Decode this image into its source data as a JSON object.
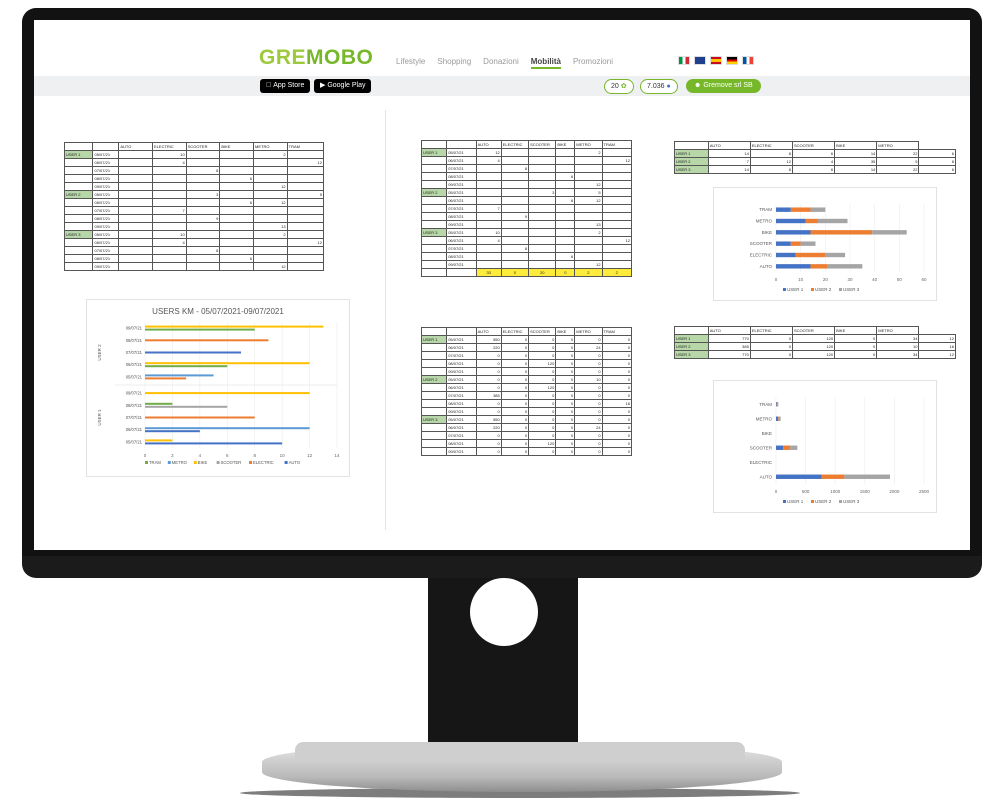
{
  "app": {
    "logo_gre": "GRE",
    "logo_mobo": "MOBO",
    "nav": [
      "Lifestyle",
      "Shopping",
      "Donazioni",
      "Mobilità",
      "Promozioni"
    ],
    "active_nav": "Mobilità",
    "store_apple": "App Store",
    "store_google": "Google Play",
    "points": "20",
    "coins": "7.036",
    "user_button": "Gremove srl SB"
  },
  "tables": {
    "headers": [
      "AUTO",
      "ELECTRIC",
      "SCOOTER",
      "BIKE",
      "METRO",
      "TRAM"
    ],
    "users": [
      "USER 1",
      "USER 2",
      "USER 3"
    ],
    "dates": [
      "05/07/21",
      "06/07/21",
      "07/07/21",
      "08/07/21",
      "09/07/21"
    ],
    "t1": [
      [
        "",
        "10",
        "",
        "",
        "2",
        ""
      ],
      [
        "",
        "4",
        "",
        "",
        "",
        "12"
      ],
      [
        "",
        "",
        "8",
        "",
        "",
        ""
      ],
      [
        "",
        "",
        "",
        "6",
        "",
        ""
      ],
      [
        "",
        "",
        "",
        "",
        "12",
        ""
      ],
      [
        "",
        "",
        "3",
        "",
        "",
        "5"
      ],
      [
        "",
        "",
        "",
        "6",
        "12",
        ""
      ],
      [
        "",
        "7",
        "",
        "",
        "",
        ""
      ],
      [
        "",
        "",
        "9",
        "",
        "",
        ""
      ],
      [
        "",
        "",
        "",
        "",
        "13",
        ""
      ],
      [
        "",
        "10",
        "",
        "",
        "2",
        ""
      ],
      [
        "",
        "4",
        "",
        "",
        "",
        "12"
      ],
      [
        "",
        "",
        "8",
        "",
        "",
        ""
      ],
      [
        "",
        "",
        "",
        "6",
        "",
        ""
      ],
      [
        "",
        "",
        "",
        "",
        "12",
        ""
      ]
    ],
    "t2": [
      [
        "12",
        "",
        "",
        "",
        "2",
        ""
      ],
      [
        "4",
        "",
        "",
        "",
        "",
        "12"
      ],
      [
        "",
        "8",
        "",
        "",
        "",
        ""
      ],
      [
        "",
        "",
        "",
        "6",
        "",
        ""
      ],
      [
        "",
        "",
        "",
        "",
        "12",
        ""
      ],
      [
        "",
        "",
        "3",
        "",
        "5",
        ""
      ],
      [
        "",
        "",
        "",
        "6",
        "12",
        ""
      ],
      [
        "7",
        "",
        "",
        "",
        "",
        ""
      ],
      [
        "",
        "9",
        "",
        "",
        "",
        ""
      ],
      [
        "",
        "",
        "",
        "",
        "13",
        ""
      ],
      [
        "10",
        "",
        "",
        "",
        "2",
        ""
      ],
      [
        "4",
        "",
        "",
        "",
        "",
        "12"
      ],
      [
        "",
        "8",
        "",
        "",
        "",
        ""
      ],
      [
        "",
        "",
        "",
        "6",
        "",
        ""
      ],
      [
        "",
        "",
        "",
        "",
        "12",
        ""
      ]
    ],
    "t2_totals": [
      "33",
      "0",
      "20",
      "0",
      "2",
      "2"
    ],
    "t3": [
      [
        "14",
        "8",
        "6",
        "14",
        "22",
        "6"
      ],
      [
        "7",
        "12",
        "4",
        "35",
        "5",
        "8"
      ],
      [
        "14",
        "8",
        "6",
        "14",
        "22",
        "6"
      ]
    ],
    "t4": [
      [
        "550",
        "0",
        "0",
        "0",
        "0",
        "0"
      ],
      [
        "220",
        "0",
        "0",
        "0",
        "24",
        "0"
      ],
      [
        "0",
        "0",
        "0",
        "0",
        "0",
        "0"
      ],
      [
        "0",
        "0",
        "120",
        "0",
        "0",
        "0"
      ],
      [
        "0",
        "0",
        "0",
        "0",
        "0",
        "0"
      ],
      [
        "0",
        "0",
        "0",
        "0",
        "10",
        "0"
      ],
      [
        "0",
        "0",
        "120",
        "0",
        "0",
        "0"
      ],
      [
        "385",
        "0",
        "0",
        "0",
        "0",
        "0"
      ],
      [
        "0",
        "0",
        "0",
        "0",
        "0",
        "16"
      ],
      [
        "0",
        "0",
        "0",
        "0",
        "0",
        "0"
      ],
      [
        "550",
        "0",
        "0",
        "0",
        "0",
        "0"
      ],
      [
        "220",
        "0",
        "0",
        "0",
        "24",
        "0"
      ],
      [
        "0",
        "0",
        "0",
        "0",
        "0",
        "0"
      ],
      [
        "0",
        "0",
        "120",
        "0",
        "0",
        "0"
      ],
      [
        "0",
        "0",
        "0",
        "0",
        "0",
        "0"
      ]
    ],
    "t5": [
      [
        "770",
        "0",
        "120",
        "0",
        "34",
        "12"
      ],
      [
        "385",
        "0",
        "120",
        "0",
        "10",
        "16"
      ],
      [
        "770",
        "0",
        "120",
        "0",
        "34",
        "12"
      ]
    ]
  },
  "colors": {
    "AUTO": "#4472c4",
    "ELECTRIC": "#ed7d31",
    "SCOOTER": "#a5a5a5",
    "BIKE": "#ffc000",
    "METRO": "#5b9bd5",
    "TRAM": "#70ad47",
    "USER 1": "#4472c4",
    "USER 2": "#ed7d31",
    "USER 3": "#a5a5a5",
    "green": "#76b82a",
    "user_cell": "#b7d7a8",
    "total_row": "#ffeb3b"
  },
  "chart_data": [
    {
      "type": "bar",
      "title": "USERS KM - 05/07/2021-09/07/2021",
      "groups": [
        "USER 1",
        "USER 2"
      ],
      "categories": [
        "05/07/21",
        "06/07/21",
        "07/07/21",
        "08/07/21",
        "09/07/21"
      ],
      "series_order": [
        "TRAM",
        "METRO",
        "BIKE",
        "SCOOTER",
        "ELECTRIC",
        "AUTO"
      ],
      "series": [
        {
          "name": "AUTO",
          "values": [
            0,
            0,
            0,
            0,
            0,
            0,
            0,
            0,
            0,
            0
          ]
        },
        {
          "name": "ELECTRIC",
          "values": [
            0,
            0,
            3,
            0,
            0,
            0,
            0,
            0,
            0,
            0
          ]
        },
        {
          "name": "SCOOTER",
          "values": [
            0,
            0,
            0,
            0,
            0,
            0,
            0,
            0,
            0,
            0
          ]
        },
        {
          "name": "BIKE",
          "values": [
            0,
            0,
            0,
            0,
            0,
            0,
            0,
            0,
            0,
            0
          ]
        },
        {
          "name": "METRO",
          "values": [
            0,
            0,
            0,
            0,
            0,
            0,
            0,
            0,
            0,
            0
          ]
        },
        {
          "name": "TRAM",
          "values": [
            0,
            0,
            0,
            0,
            0,
            0,
            0,
            0,
            0,
            0
          ]
        }
      ],
      "bars": [
        [
          "USER 2",
          "09/07/21",
          "BIKE",
          13
        ],
        [
          "USER 2",
          "09/07/21",
          "TRAM",
          8
        ],
        [
          "USER 2",
          "08/07/21",
          "ELECTRIC",
          9
        ],
        [
          "USER 2",
          "07/07/21",
          "AUTO",
          7
        ],
        [
          "USER 2",
          "06/07/21",
          "BIKE",
          12
        ],
        [
          "USER 2",
          "06/07/21",
          "TRAM",
          6
        ],
        [
          "USER 2",
          "05/07/21",
          "METRO",
          5
        ],
        [
          "USER 2",
          "05/07/21",
          "ELECTRIC",
          3
        ],
        [
          "USER 1",
          "09/07/21",
          "BIKE",
          12
        ],
        [
          "USER 1",
          "08/07/21",
          "TRAM",
          2
        ],
        [
          "USER 1",
          "08/07/21",
          "SCOOTER",
          6
        ],
        [
          "USER 1",
          "07/07/21",
          "ELECTRIC",
          8
        ],
        [
          "USER 1",
          "06/07/21",
          "METRO",
          12
        ],
        [
          "USER 1",
          "06/07/21",
          "AUTO",
          4
        ],
        [
          "USER 1",
          "05/07/21",
          "BIKE",
          2
        ],
        [
          "USER 1",
          "05/07/21",
          "AUTO",
          10
        ]
      ],
      "xticks": [
        "0",
        "2",
        "4",
        "6",
        "8",
        "10",
        "12",
        "14"
      ],
      "xlim": [
        0,
        14
      ],
      "legend": [
        "TRAM",
        "METRO",
        "BIKE",
        "SCOOTER",
        "ELECTRIC",
        "AUTO"
      ],
      "legend_position": "bottom"
    },
    {
      "type": "bar",
      "stacked": true,
      "categories": [
        "TRAM",
        "METRO",
        "BIKE",
        "SCOOTER",
        "ELECTRIC",
        "AUTO"
      ],
      "series": [
        {
          "name": "USER 1",
          "values": [
            6,
            12,
            14,
            6,
            8,
            14
          ]
        },
        {
          "name": "USER 2",
          "values": [
            8,
            5,
            25,
            4,
            12,
            7
          ]
        },
        {
          "name": "USER 3",
          "values": [
            6,
            12,
            14,
            6,
            8,
            14
          ]
        }
      ],
      "xticks": [
        "0",
        "10",
        "20",
        "30",
        "40",
        "50",
        "60"
      ],
      "xlim": [
        0,
        60
      ],
      "legend_position": "bottom"
    },
    {
      "type": "bar",
      "stacked": true,
      "categories": [
        "TRAM",
        "METRO",
        "BIKE",
        "SCOOTER",
        "ELECTRIC",
        "AUTO"
      ],
      "series": [
        {
          "name": "USER 1",
          "values": [
            12,
            34,
            0,
            120,
            0,
            770
          ]
        },
        {
          "name": "USER 2",
          "values": [
            16,
            10,
            0,
            120,
            0,
            385
          ]
        },
        {
          "name": "USER 3",
          "values": [
            12,
            34,
            0,
            120,
            0,
            770
          ]
        }
      ],
      "xticks": [
        "0",
        "500",
        "1000",
        "1500",
        "2000",
        "2500"
      ],
      "xlim": [
        0,
        2500
      ],
      "legend_position": "bottom"
    }
  ]
}
